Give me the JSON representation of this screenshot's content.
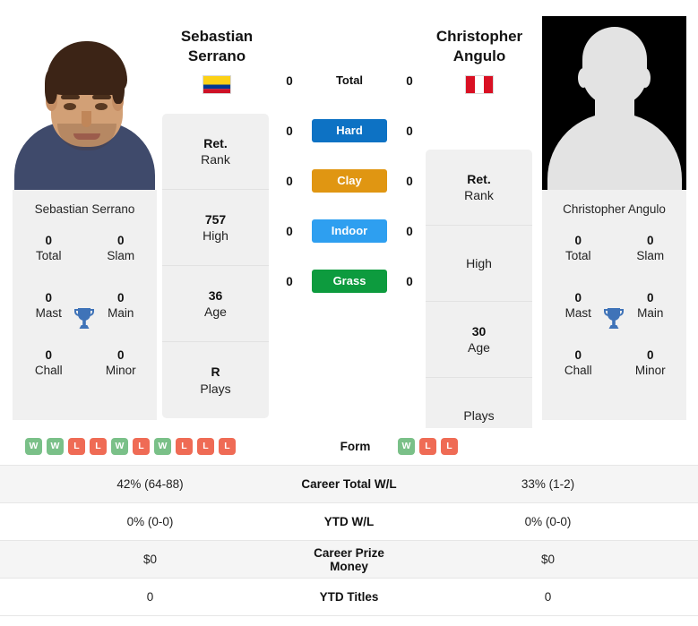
{
  "players": {
    "left": {
      "name_line1": "Sebastian",
      "name_line2": "Serrano",
      "full_name": "Sebastian Serrano",
      "flag_name": "colombia-flag",
      "flag_colors": [
        "#FCD116",
        "#003893",
        "#CE1126"
      ],
      "photo_name": "player-photo-sebastian-serrano",
      "stats": [
        {
          "value": "Ret.",
          "label": "Rank"
        },
        {
          "value": "757",
          "label": "High"
        },
        {
          "value": "36",
          "label": "Age"
        },
        {
          "value": "R",
          "label": "Plays"
        }
      ],
      "titles": [
        {
          "value": "0",
          "label": "Total"
        },
        {
          "value": "0",
          "label": "Slam"
        },
        {
          "value": "0",
          "label": "Mast"
        },
        {
          "value": "0",
          "label": "Main"
        },
        {
          "value": "0",
          "label": "Chall"
        },
        {
          "value": "0",
          "label": "Minor"
        }
      ],
      "surface_wins": {
        "total": "0",
        "hard": "0",
        "clay": "0",
        "indoor": "0",
        "grass": "0"
      },
      "form": [
        "W",
        "W",
        "L",
        "L",
        "W",
        "L",
        "W",
        "L",
        "L",
        "L"
      ],
      "career_total_wl": "42% (64-88)",
      "ytd_wl": "0% (0-0)",
      "career_prize_money": "$0",
      "ytd_titles": "0"
    },
    "right": {
      "name_line1": "Christopher",
      "name_line2": "Angulo",
      "full_name": "Christopher Angulo",
      "flag_name": "peru-flag",
      "flag_colors": [
        "#D91023",
        "#FFFFFF",
        "#D91023"
      ],
      "photo_name": "player-photo-placeholder-silhouette",
      "stats": [
        {
          "value": "Ret.",
          "label": "Rank"
        },
        {
          "value": "",
          "label": "High"
        },
        {
          "value": "30",
          "label": "Age"
        },
        {
          "value": "",
          "label": "Plays"
        }
      ],
      "titles": [
        {
          "value": "0",
          "label": "Total"
        },
        {
          "value": "0",
          "label": "Slam"
        },
        {
          "value": "0",
          "label": "Mast"
        },
        {
          "value": "0",
          "label": "Main"
        },
        {
          "value": "0",
          "label": "Chall"
        },
        {
          "value": "0",
          "label": "Minor"
        }
      ],
      "surface_wins": {
        "total": "0",
        "hard": "0",
        "clay": "0",
        "indoor": "0",
        "grass": "0"
      },
      "form": [
        "W",
        "L",
        "L"
      ],
      "career_total_wl": "33% (1-2)",
      "ytd_wl": "0% (0-0)",
      "career_prize_money": "$0",
      "ytd_titles": "0"
    }
  },
  "surfaces": [
    {
      "key": "total",
      "label": "Total",
      "color": "none",
      "plain": true
    },
    {
      "key": "hard",
      "label": "Hard",
      "color": "#0d72c4",
      "plain": false
    },
    {
      "key": "clay",
      "label": "Clay",
      "color": "#e09612",
      "plain": false
    },
    {
      "key": "indoor",
      "label": "Indoor",
      "color": "#2e9ff0",
      "plain": false
    },
    {
      "key": "grass",
      "label": "Grass",
      "color": "#0d9b3e",
      "plain": false
    }
  ],
  "comparison_rows": [
    {
      "label": "Form",
      "left": "",
      "right": "",
      "type": "form"
    },
    {
      "label": "Career Total W/L",
      "left": "42% (64-88)",
      "right": "33% (1-2)",
      "type": "text"
    },
    {
      "label": "YTD W/L",
      "left": "0% (0-0)",
      "right": "0% (0-0)",
      "type": "text"
    },
    {
      "label": "Career Prize Money",
      "left": "$0",
      "right": "$0",
      "type": "text"
    },
    {
      "label": "YTD Titles",
      "left": "0",
      "right": "0",
      "type": "text"
    }
  ],
  "colors": {
    "win_badge": "#7ac088",
    "loss_badge": "#ef6b55",
    "trophy": "#3f73b8",
    "panel_bg": "#f0f0f0",
    "row_alt_bg": "#f5f5f5"
  },
  "icons": {
    "trophy": "trophy-icon"
  }
}
